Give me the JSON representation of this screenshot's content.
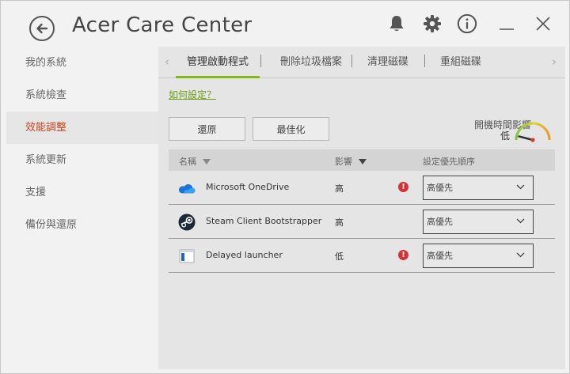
{
  "app": {
    "title": "Acer Care Center"
  },
  "titlebar": {
    "icons": [
      "back-icon",
      "bell-icon",
      "gear-icon",
      "info-icon",
      "minimize-icon",
      "close-icon"
    ]
  },
  "sidebar": {
    "items": [
      {
        "label": "我的系統",
        "active": false
      },
      {
        "label": "系統檢查",
        "active": false
      },
      {
        "label": "效能調整",
        "active": true
      },
      {
        "label": "系統更新",
        "active": false
      },
      {
        "label": "支援",
        "active": false
      },
      {
        "label": "備份與還原",
        "active": false
      }
    ]
  },
  "tabs": {
    "items": [
      {
        "label": "管理啟動程式",
        "active": true
      },
      {
        "label": "刪除垃圾檔案",
        "active": false
      },
      {
        "label": "清理磁碟",
        "active": false
      },
      {
        "label": "重組磁碟",
        "active": false
      }
    ],
    "left_arrow": "‹",
    "right_arrow": "›"
  },
  "howto_link": "如何設定？",
  "buttons": {
    "restore": "還原",
    "optimize": "最佳化"
  },
  "boot_impact": {
    "title": "開機時間影響",
    "level": "低",
    "level_fraction": 0.08
  },
  "table": {
    "headers": {
      "name": "名稱",
      "impact": "影響",
      "priority": "設定優先順序"
    },
    "rows": [
      {
        "name": "Microsoft OneDrive",
        "impact": "高",
        "warning": true,
        "priority": "高優先",
        "icon": "onedrive-icon"
      },
      {
        "name": "Steam Client Bootstrapper",
        "impact": "高",
        "warning": false,
        "priority": "高優先",
        "icon": "steam-icon"
      },
      {
        "name": "Delayed launcher",
        "impact": "低",
        "warning": true,
        "priority": "高優先",
        "icon": "app-window-icon"
      }
    ]
  },
  "colors": {
    "accent_green": "#83b81a",
    "active_red": "#c8461e",
    "warning_red": "#d13438"
  }
}
